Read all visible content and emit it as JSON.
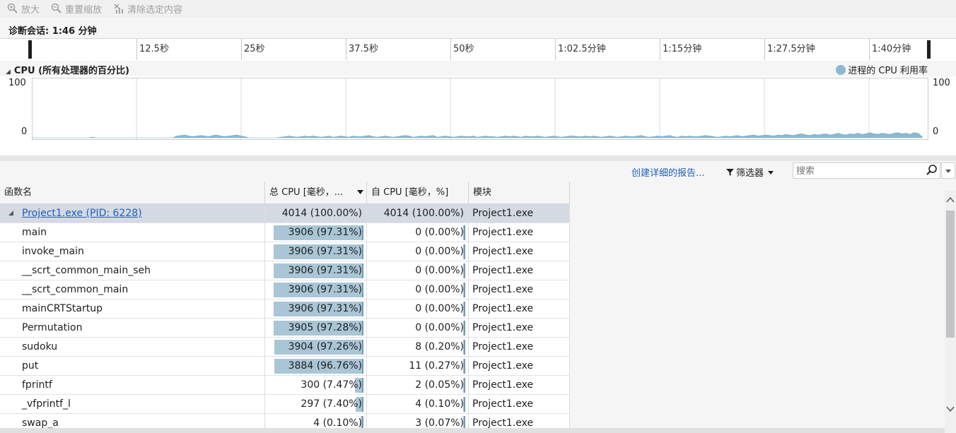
{
  "toolbar": {
    "zoom_in": "放大",
    "reset_zoom": "重置缩放",
    "clear_selection": "清除选定内容"
  },
  "session": {
    "label": "诊断会话: 1:46 分钟"
  },
  "ruler": {
    "ticks": [
      "12.5秒",
      "25秒",
      "37.5秒",
      "50秒",
      "1:02.5分钟",
      "1:15分钟",
      "1:27.5分钟",
      "1:40分钟"
    ]
  },
  "cpu": {
    "title": "CPU (所有处理器的百分比)",
    "legend": "进程的 CPU 利用率",
    "legend_color": "#8cb8d2",
    "y_max": "100",
    "y_min": "0"
  },
  "chart_data": {
    "type": "area",
    "ylim": [
      0,
      100
    ],
    "values": [
      0,
      0,
      0,
      0,
      0,
      0,
      0,
      0,
      0,
      0,
      0,
      0,
      0,
      0,
      0,
      1,
      0,
      0,
      0,
      0,
      0,
      0,
      0,
      0,
      0,
      0,
      0,
      0,
      0,
      0,
      0,
      0,
      0,
      0,
      0,
      0,
      3,
      4,
      5,
      3,
      2,
      3,
      4,
      3,
      2,
      4,
      5,
      3,
      2,
      3,
      4,
      5,
      3,
      2,
      0,
      0,
      0,
      0,
      0,
      0,
      0,
      0,
      1,
      2,
      3,
      2,
      1,
      2,
      3,
      2,
      3,
      2,
      1,
      2,
      3,
      1,
      2,
      3,
      2,
      1,
      3,
      2,
      2,
      3,
      4,
      2,
      1,
      2,
      3,
      2,
      1,
      2,
      3,
      4,
      3,
      1,
      2,
      3,
      2,
      3,
      4,
      1,
      2,
      3,
      2,
      1,
      2,
      3,
      2,
      2,
      3,
      1,
      2,
      3,
      2,
      2,
      1,
      2,
      3,
      2,
      3,
      2,
      1,
      3,
      2,
      2,
      3,
      2,
      1,
      2,
      3,
      2,
      1,
      2,
      3,
      3,
      2,
      2,
      3,
      2,
      3,
      2,
      1,
      2,
      3,
      2,
      1,
      2,
      3,
      2,
      2,
      3,
      4,
      2,
      1,
      2,
      3,
      2,
      3,
      4,
      2,
      1,
      3,
      2,
      3,
      2,
      2,
      3,
      4,
      3,
      2,
      1,
      2,
      3,
      2,
      3,
      4,
      2,
      3,
      4,
      5,
      3,
      4,
      5,
      4,
      3,
      5,
      4,
      6,
      5,
      4,
      6,
      7,
      5,
      4,
      6,
      5,
      6,
      7,
      5,
      6,
      8,
      6,
      5,
      7,
      6,
      8,
      6,
      7,
      9,
      7,
      6,
      8,
      7,
      6,
      8,
      9,
      7,
      8,
      6,
      9,
      8,
      2
    ]
  },
  "actions": {
    "report_link": "创建详细的报告...",
    "filter_label": "筛选器",
    "search_placeholder": "搜索"
  },
  "table": {
    "headers": {
      "name": "函数名",
      "total": "总 CPU [毫秒，...",
      "self": "自 CPU [毫秒，%]",
      "module": "模块"
    },
    "rows": [
      {
        "name": "Project1.exe (PID: 6228)",
        "total": "4014 (100.00%)",
        "self": "4014 (100.00%)",
        "module": "Project1.exe",
        "total_pct": 100.0,
        "self_pct": 100.0
      },
      {
        "name": "main",
        "total": "3906 (97.31%)",
        "self": "0 (0.00%)",
        "module": "Project1.exe",
        "total_pct": 97.31,
        "self_pct": 0.0
      },
      {
        "name": "invoke_main",
        "total": "3906 (97.31%)",
        "self": "0 (0.00%)",
        "module": "Project1.exe",
        "total_pct": 97.31,
        "self_pct": 0.0
      },
      {
        "name": "__scrt_common_main_seh",
        "total": "3906 (97.31%)",
        "self": "0 (0.00%)",
        "module": "Project1.exe",
        "total_pct": 97.31,
        "self_pct": 0.0
      },
      {
        "name": "__scrt_common_main",
        "total": "3906 (97.31%)",
        "self": "0 (0.00%)",
        "module": "Project1.exe",
        "total_pct": 97.31,
        "self_pct": 0.0
      },
      {
        "name": "mainCRTStartup",
        "total": "3906 (97.31%)",
        "self": "0 (0.00%)",
        "module": "Project1.exe",
        "total_pct": 97.31,
        "self_pct": 0.0
      },
      {
        "name": "Permutation",
        "total": "3905 (97.28%)",
        "self": "0 (0.00%)",
        "module": "Project1.exe",
        "total_pct": 97.28,
        "self_pct": 0.0
      },
      {
        "name": "sudoku",
        "total": "3904 (97.26%)",
        "self": "8 (0.20%)",
        "module": "Project1.exe",
        "total_pct": 97.26,
        "self_pct": 0.2
      },
      {
        "name": "put",
        "total": "3884 (96.76%)",
        "self": "11 (0.27%)",
        "module": "Project1.exe",
        "total_pct": 96.76,
        "self_pct": 0.27
      },
      {
        "name": "fprintf",
        "total": "300 (7.47%)",
        "self": "2 (0.05%)",
        "module": "Project1.exe",
        "total_pct": 7.47,
        "self_pct": 0.05
      },
      {
        "name": "_vfprintf_l",
        "total": "297 (7.40%)",
        "self": "4 (0.10%)",
        "module": "Project1.exe",
        "total_pct": 7.4,
        "self_pct": 0.1
      },
      {
        "name": "swap_a",
        "total": "4 (0.10%)",
        "self": "3 (0.07%)",
        "module": "Project1.exe",
        "total_pct": 0.1,
        "self_pct": 0.07
      }
    ]
  }
}
